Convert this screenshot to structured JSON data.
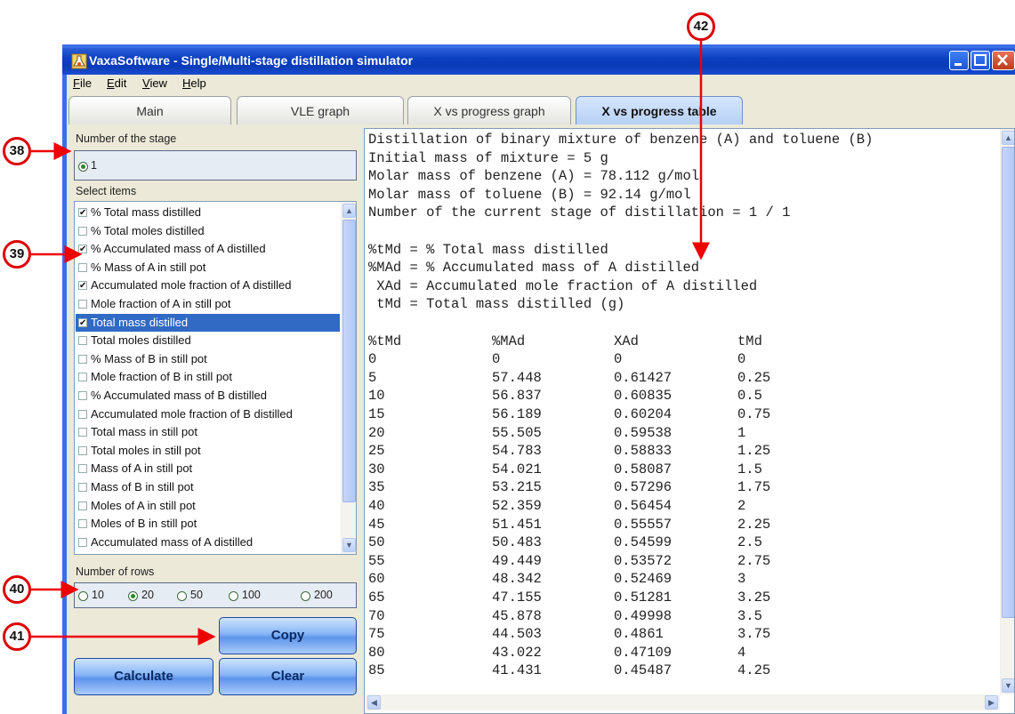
{
  "window": {
    "title": "VaxaSoftware - Single/Multi-stage distillation simulator"
  },
  "menu": [
    "File",
    "Edit",
    "View",
    "Help"
  ],
  "tabs": [
    {
      "label": "Main",
      "active": false
    },
    {
      "label": "VLE graph",
      "active": false
    },
    {
      "label": "X vs progress graph",
      "active": false
    },
    {
      "label": "X vs progress table",
      "active": true
    }
  ],
  "stage": {
    "label": "Number of the stage",
    "option": "1"
  },
  "select_items": {
    "label": "Select items",
    "items": [
      {
        "label": "% Total mass distilled",
        "checked": true,
        "selected": false
      },
      {
        "label": "% Total moles distilled",
        "checked": false,
        "selected": false
      },
      {
        "label": "% Accumulated mass of A distilled",
        "checked": true,
        "selected": false
      },
      {
        "label": "% Mass of A in still pot",
        "checked": false,
        "selected": false
      },
      {
        "label": "Accumulated mole fraction of A distilled",
        "checked": true,
        "selected": false
      },
      {
        "label": "Mole fraction of A in still pot",
        "checked": false,
        "selected": false
      },
      {
        "label": "Total mass distilled",
        "checked": true,
        "selected": true
      },
      {
        "label": "Total moles distilled",
        "checked": false,
        "selected": false
      },
      {
        "label": "% Mass of B in still pot",
        "checked": false,
        "selected": false
      },
      {
        "label": "Mole fraction of B in still pot",
        "checked": false,
        "selected": false
      },
      {
        "label": "% Accumulated mass of B distilled",
        "checked": false,
        "selected": false
      },
      {
        "label": "Accumulated mole fraction of B distilled",
        "checked": false,
        "selected": false
      },
      {
        "label": "Total mass in still pot",
        "checked": false,
        "selected": false
      },
      {
        "label": "Total moles in still pot",
        "checked": false,
        "selected": false
      },
      {
        "label": "Mass of A in still pot",
        "checked": false,
        "selected": false
      },
      {
        "label": "Mass of B in still pot",
        "checked": false,
        "selected": false
      },
      {
        "label": "Moles of A in still pot",
        "checked": false,
        "selected": false
      },
      {
        "label": "Moles of B in still pot",
        "checked": false,
        "selected": false
      },
      {
        "label": "Accumulated mass of A distilled",
        "checked": false,
        "selected": false
      }
    ]
  },
  "rows": {
    "label": "Number of rows",
    "options": [
      "10",
      "20",
      "50",
      "100",
      "200"
    ],
    "selected": "20"
  },
  "buttons": {
    "copy": "Copy",
    "calculate": "Calculate",
    "clear": "Clear"
  },
  "output": {
    "header_lines": [
      "Distillation of binary mixture of benzene (A) and toluene (B)",
      "Initial mass of mixture = 5 g",
      "Molar mass of benzene (A) = 78.112 g/mol",
      "Molar mass of toluene (B) = 92.14 g/mol",
      "Number of the current stage of distillation = 1 / 1"
    ],
    "legend_lines": [
      "%tMd = % Total mass distilled",
      "%MAd = % Accumulated mass of A distilled",
      " XAd = Accumulated mole fraction of A distilled",
      " tMd = Total mass distilled (g)"
    ],
    "table_header": [
      "%tMd",
      "%MAd",
      "XAd",
      "tMd"
    ],
    "table_rows": [
      [
        "0",
        "0",
        "0",
        "0"
      ],
      [
        "5",
        "57.448",
        "0.61427",
        "0.25"
      ],
      [
        "10",
        "56.837",
        "0.60835",
        "0.5"
      ],
      [
        "15",
        "56.189",
        "0.60204",
        "0.75"
      ],
      [
        "20",
        "55.505",
        "0.59538",
        "1"
      ],
      [
        "25",
        "54.783",
        "0.58833",
        "1.25"
      ],
      [
        "30",
        "54.021",
        "0.58087",
        "1.5"
      ],
      [
        "35",
        "53.215",
        "0.57296",
        "1.75"
      ],
      [
        "40",
        "52.359",
        "0.56454",
        "2"
      ],
      [
        "45",
        "51.451",
        "0.55557",
        "2.25"
      ],
      [
        "50",
        "50.483",
        "0.54599",
        "2.5"
      ],
      [
        "55",
        "49.449",
        "0.53572",
        "2.75"
      ],
      [
        "60",
        "48.342",
        "0.52469",
        "3"
      ],
      [
        "65",
        "47.155",
        "0.51281",
        "3.25"
      ],
      [
        "70",
        "45.878",
        "0.49998",
        "3.5"
      ],
      [
        "75",
        "44.503",
        "0.4861",
        "3.75"
      ],
      [
        "80",
        "43.022",
        "0.47109",
        "4"
      ],
      [
        "85",
        "41.431",
        "0.45487",
        "4.25"
      ]
    ]
  },
  "callouts": [
    "38",
    "39",
    "40",
    "41",
    "42"
  ],
  "colors": {
    "callout_border": "#dd0000",
    "selection": "#316ac5",
    "titlebar": "#0a3fc0"
  }
}
